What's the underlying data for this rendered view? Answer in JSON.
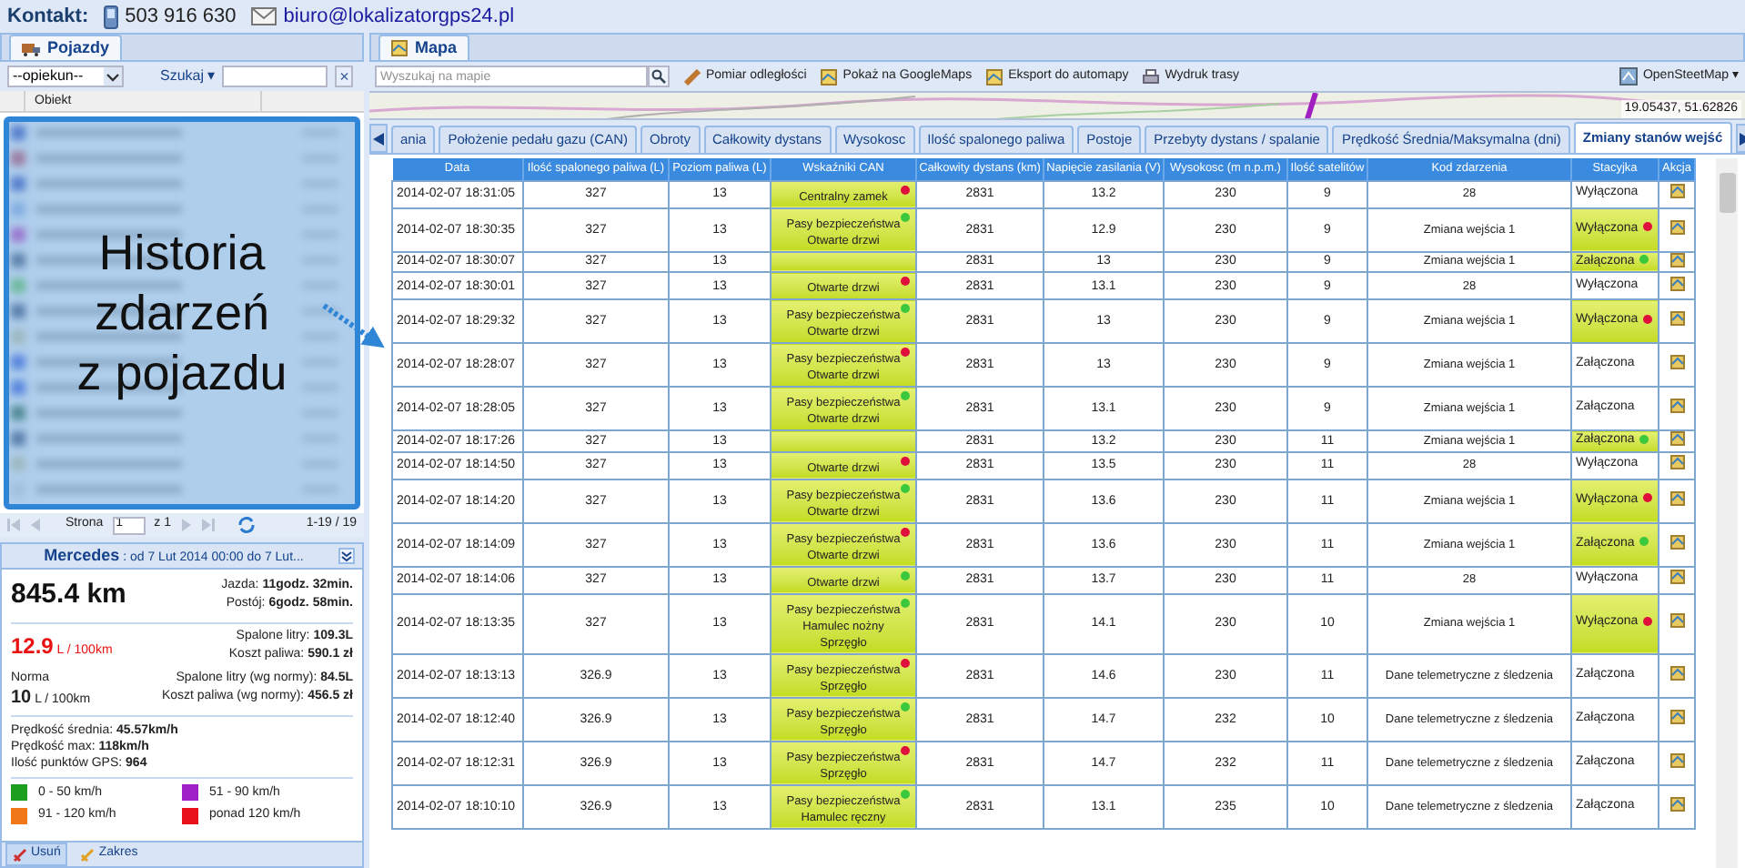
{
  "contact": {
    "label": "Kontakt:",
    "phone": "503 916 630",
    "email": "biuro@lokalizatorgps24.pl"
  },
  "left_panel": {
    "tab": {
      "label": "Pojazdy",
      "selected": true
    },
    "filter": {
      "select_value": "--opiekun--",
      "search_label": "Szukaj ▾",
      "clear": "×"
    },
    "list_header": "Obiekt",
    "overlay_caption_lines": [
      "Historia",
      "zdarzeń",
      "z pojazdu"
    ],
    "pager": {
      "page_label": "Strona",
      "page_value": "1",
      "of": "z 1",
      "range": "1-19 / 19"
    },
    "summary": {
      "vehicle": "Mercedes",
      "period": ": od 7 Lut 2014 00:00 do 7 Lut...",
      "distance": "845.4 km",
      "drive": [
        {
          "label": "Jazda:",
          "value": "11godz. 32min."
        },
        {
          "label": "Postój:",
          "value": "6godz. 58min."
        }
      ],
      "consumption": "12.9",
      "consumption_unit": "L / 100km",
      "burned": [
        {
          "label": "Spalone litry:",
          "value": "109.3L"
        },
        {
          "label": "Koszt paliwa:",
          "value": "590.1 zł"
        }
      ],
      "norm_label": "Norma",
      "norm_value": "10",
      "norm_unit": "L / 100km",
      "burned_norm": [
        {
          "label": "Spalone litry (wg normy):",
          "value": "84.5L"
        },
        {
          "label": "Koszt paliwa (wg normy):",
          "value": "456.5 zł"
        }
      ],
      "speeds": [
        {
          "label": "Prędkość średnia:",
          "value": "45.57km/h"
        },
        {
          "label": "Prędkość max:",
          "value": "118km/h"
        },
        {
          "label": "Ilość punktów GPS:",
          "value": "964"
        }
      ],
      "legend": [
        {
          "label": "0 - 50 km/h",
          "color": "#1e9e1e"
        },
        {
          "label": "51 - 90 km/h",
          "color": "#a020c8"
        },
        {
          "label": "91 - 120 km/h",
          "color": "#f07818"
        },
        {
          "label": "ponad 120 km/h",
          "color": "#e8101a"
        }
      ]
    },
    "buttons": [
      "Usuń",
      "Zakres"
    ]
  },
  "right_panel": {
    "tab": {
      "label": "Mapa",
      "selected": true
    },
    "toolbar": {
      "search_placeholder": "Wyszukaj na mapie",
      "actions": [
        "Pomiar odległości",
        "Pokaż na GoogleMaps",
        "Eksport do automapy",
        "Wydruk trasy"
      ],
      "map_type": "OpenSteetMap ▾"
    },
    "map": {
      "coordinates": "19.05437, 51.62826"
    },
    "report_tabs": [
      {
        "label": "ania",
        "selected": false
      },
      {
        "label": "Położenie pedału gazu (CAN)",
        "selected": false
      },
      {
        "label": "Obroty",
        "selected": false
      },
      {
        "label": "Całkowity dystans",
        "selected": false
      },
      {
        "label": "Wysokosc",
        "selected": false
      },
      {
        "label": "Ilość spalonego paliwa",
        "selected": false
      },
      {
        "label": "Postoje",
        "selected": false
      },
      {
        "label": "Przebyty dystans / spalanie",
        "selected": false
      },
      {
        "label": "Prędkość Średnia/Maksymalna (dni)",
        "selected": false
      },
      {
        "label": "Zmiany stanów wejść",
        "selected": true
      }
    ],
    "table": {
      "columns": [
        "Data",
        "Ilość spalonego paliwa (L)",
        "Poziom paliwa (L)",
        "Wskaźniki CAN",
        "Całkowity dystans (km)",
        "Napięcie zasilania (V)",
        "Wysokosc (m n.p.m.)",
        "Ilość satelitów",
        "Kod zdarzenia",
        "Stacyjka",
        "Akcja"
      ],
      "rows": [
        {
          "date": "2014-02-07 18:31:05",
          "fuel_used": "327",
          "fuel_level": "13",
          "can": {
            "lines": [
              "Centralny zamek"
            ],
            "color": "#e0103c"
          },
          "distance": "2831",
          "voltage": "13.2",
          "altitude": "230",
          "satellites": "9",
          "event": "28",
          "ignition": {
            "text": "Wyłączona",
            "highlighted": false
          }
        },
        {
          "date": "2014-02-07 18:30:35",
          "fuel_used": "327",
          "fuel_level": "13",
          "can": {
            "lines": [
              "Pasy bezpieczeństwa",
              "Otwarte drzwi"
            ],
            "color": "#3cc83c"
          },
          "distance": "2831",
          "voltage": "12.9",
          "altitude": "230",
          "satellites": "9",
          "event": "Zmiana wejścia 1",
          "ignition": {
            "text": "Wyłączona",
            "highlighted": true,
            "color": "#e0103c"
          }
        },
        {
          "date": "2014-02-07 18:30:07",
          "fuel_used": "327",
          "fuel_level": "13",
          "can": {},
          "distance": "2831",
          "voltage": "13",
          "altitude": "230",
          "satellites": "9",
          "event": "Zmiana wejścia 1",
          "ignition": {
            "text": "Załączona",
            "highlighted": true,
            "color": "#3cc83c"
          }
        },
        {
          "date": "2014-02-07 18:30:01",
          "fuel_used": "327",
          "fuel_level": "13",
          "can": {
            "lines": [
              "Otwarte drzwi"
            ],
            "color": "#e0103c"
          },
          "distance": "2831",
          "voltage": "13.1",
          "altitude": "230",
          "satellites": "9",
          "event": "28",
          "ignition": {
            "text": "Wyłączona",
            "highlighted": false
          }
        },
        {
          "date": "2014-02-07 18:29:32",
          "fuel_used": "327",
          "fuel_level": "13",
          "can": {
            "lines": [
              "Pasy bezpieczeństwa",
              "Otwarte drzwi"
            ],
            "color": "#3cc83c"
          },
          "distance": "2831",
          "voltage": "13",
          "altitude": "230",
          "satellites": "9",
          "event": "Zmiana wejścia 1",
          "ignition": {
            "text": "Wyłączona",
            "highlighted": true,
            "color": "#e0103c"
          }
        },
        {
          "date": "2014-02-07 18:28:07",
          "fuel_used": "327",
          "fuel_level": "13",
          "can": {
            "lines": [
              "Pasy bezpieczeństwa",
              "Otwarte drzwi"
            ],
            "color": "#e0103c"
          },
          "distance": "2831",
          "voltage": "13",
          "altitude": "230",
          "satellites": "9",
          "event": "Zmiana wejścia 1",
          "ignition": {
            "text": "Załączona",
            "highlighted": false
          }
        },
        {
          "date": "2014-02-07 18:28:05",
          "fuel_used": "327",
          "fuel_level": "13",
          "can": {
            "lines": [
              "Pasy bezpieczeństwa",
              "Otwarte drzwi"
            ],
            "color": "#3cc83c"
          },
          "distance": "2831",
          "voltage": "13.1",
          "altitude": "230",
          "satellites": "9",
          "event": "Zmiana wejścia 1",
          "ignition": {
            "text": "Załączona",
            "highlighted": false
          }
        },
        {
          "date": "2014-02-07 18:17:26",
          "fuel_used": "327",
          "fuel_level": "13",
          "can": {},
          "distance": "2831",
          "voltage": "13.2",
          "altitude": "230",
          "satellites": "11",
          "event": "Zmiana wejścia 1",
          "ignition": {
            "text": "Załączona",
            "highlighted": true,
            "color": "#3cc83c"
          }
        },
        {
          "date": "2014-02-07 18:14:50",
          "fuel_used": "327",
          "fuel_level": "13",
          "can": {
            "lines": [
              "Otwarte drzwi"
            ],
            "color": "#e0103c"
          },
          "distance": "2831",
          "voltage": "13.5",
          "altitude": "230",
          "satellites": "11",
          "event": "28",
          "ignition": {
            "text": "Wyłączona",
            "highlighted": false
          }
        },
        {
          "date": "2014-02-07 18:14:20",
          "fuel_used": "327",
          "fuel_level": "13",
          "can": {
            "lines": [
              "Pasy bezpieczeństwa",
              "Otwarte drzwi"
            ],
            "color": "#3cc83c"
          },
          "distance": "2831",
          "voltage": "13.6",
          "altitude": "230",
          "satellites": "11",
          "event": "Zmiana wejścia 1",
          "ignition": {
            "text": "Wyłączona",
            "highlighted": true,
            "color": "#e0103c"
          }
        },
        {
          "date": "2014-02-07 18:14:09",
          "fuel_used": "327",
          "fuel_level": "13",
          "can": {
            "lines": [
              "Pasy bezpieczeństwa",
              "Otwarte drzwi"
            ],
            "color": "#e0103c"
          },
          "distance": "2831",
          "voltage": "13.6",
          "altitude": "230",
          "satellites": "11",
          "event": "Zmiana wejścia 1",
          "ignition": {
            "text": "Załączona",
            "highlighted": true,
            "color": "#3cc83c"
          }
        },
        {
          "date": "2014-02-07 18:14:06",
          "fuel_used": "327",
          "fuel_level": "13",
          "can": {
            "lines": [
              "Otwarte drzwi"
            ],
            "color": "#3cc83c"
          },
          "distance": "2831",
          "voltage": "13.7",
          "altitude": "230",
          "satellites": "11",
          "event": "28",
          "ignition": {
            "text": "Wyłączona",
            "highlighted": false
          }
        },
        {
          "date": "2014-02-07 18:13:35",
          "fuel_used": "327",
          "fuel_level": "13",
          "can": {
            "lines": [
              "Pasy bezpieczeństwa",
              "Hamulec nożny",
              "Sprzęgło"
            ],
            "color": "#3cc83c"
          },
          "distance": "2831",
          "voltage": "14.1",
          "altitude": "230",
          "satellites": "10",
          "event": "Zmiana wejścia 1",
          "ignition": {
            "text": "Wyłączona",
            "highlighted": true,
            "color": "#e0103c"
          }
        },
        {
          "date": "2014-02-07 18:13:13",
          "fuel_used": "326.9",
          "fuel_level": "13",
          "can": {
            "lines": [
              "Pasy bezpieczeństwa",
              "Sprzęgło"
            ],
            "color": "#e0103c"
          },
          "distance": "2831",
          "voltage": "14.6",
          "altitude": "230",
          "satellites": "11",
          "event": "Dane telemetryczne z śledzenia",
          "ignition": {
            "text": "Załączona",
            "highlighted": false
          }
        },
        {
          "date": "2014-02-07 18:12:40",
          "fuel_used": "326.9",
          "fuel_level": "13",
          "can": {
            "lines": [
              "Pasy bezpieczeństwa",
              "Sprzęgło"
            ],
            "color": "#3cc83c"
          },
          "distance": "2831",
          "voltage": "14.7",
          "altitude": "232",
          "satellites": "10",
          "event": "Dane telemetryczne z śledzenia",
          "ignition": {
            "text": "Załączona",
            "highlighted": false
          }
        },
        {
          "date": "2014-02-07 18:12:31",
          "fuel_used": "326.9",
          "fuel_level": "13",
          "can": {
            "lines": [
              "Pasy bezpieczeństwa",
              "Sprzęgło"
            ],
            "color": "#e0103c"
          },
          "distance": "2831",
          "voltage": "14.7",
          "altitude": "232",
          "satellites": "11",
          "event": "Dane telemetryczne z śledzenia",
          "ignition": {
            "text": "Załączona",
            "highlighted": false
          }
        },
        {
          "date": "2014-02-07 18:10:10",
          "fuel_used": "326.9",
          "fuel_level": "13",
          "can": {
            "lines": [
              "Pasy bezpieczeństwa",
              "Hamulec ręczny"
            ],
            "color": "#3cc83c"
          },
          "distance": "2831",
          "voltage": "13.1",
          "altitude": "235",
          "satellites": "10",
          "event": "Dane telemetryczne z śledzenia",
          "ignition": {
            "text": "Załączona",
            "highlighted": false
          }
        }
      ]
    }
  }
}
